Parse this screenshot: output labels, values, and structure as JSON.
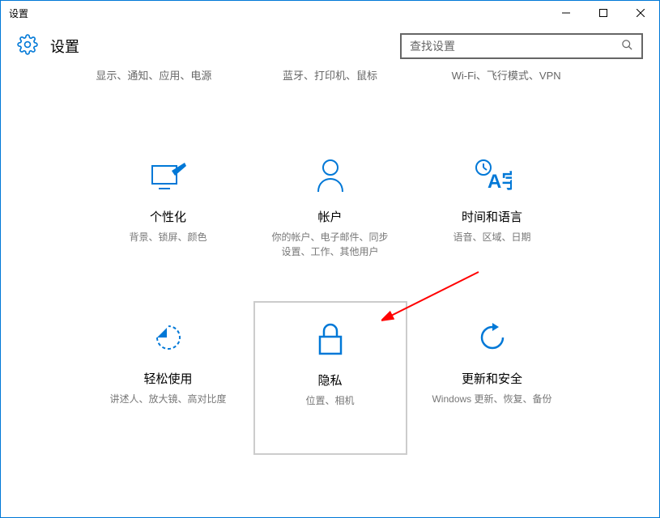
{
  "titlebar": {
    "title": "设置"
  },
  "header": {
    "title": "设置"
  },
  "search": {
    "placeholder": "查找设置"
  },
  "descRow": [
    {
      "text": "显示、通知、应用、电源"
    },
    {
      "text": "蓝牙、打印机、鼠标"
    },
    {
      "text": "Wi-Fi、飞行模式、VPN"
    }
  ],
  "tiles": [
    {
      "title": "个性化",
      "desc": "背景、锁屏、颜色"
    },
    {
      "title": "帐户",
      "desc": "你的帐户、电子邮件、同步设置、工作、其他用户"
    },
    {
      "title": "时间和语言",
      "desc": "语音、区域、日期"
    },
    {
      "title": "轻松使用",
      "desc": "讲述人、放大镜、高对比度"
    },
    {
      "title": "隐私",
      "desc": "位置、相机"
    },
    {
      "title": "更新和安全",
      "desc": "Windows 更新、恢复、备份"
    }
  ]
}
